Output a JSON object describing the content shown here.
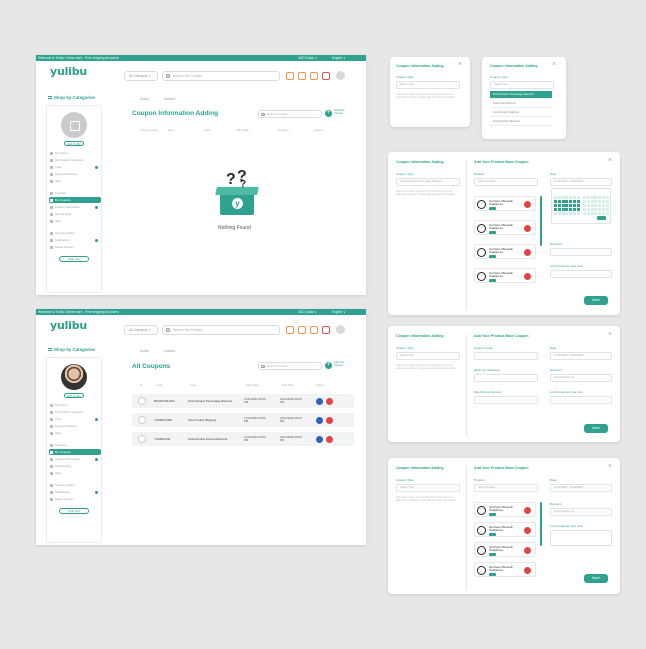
{
  "header": {
    "promo": "Welcome to Yulibu Online store - Free shipping all orders",
    "lang1": "USD Dollar ∨",
    "lang2": "English ∨",
    "logo": "yulibu",
    "category": "All Category ∨",
    "search_placeholder": "Search the Product",
    "colors": {
      "brand": "#2fa18e"
    }
  },
  "sidebar": {
    "title": "Shop by Categories",
    "edit": "Edit Profile",
    "items": [
      "My Orders",
      "My Product Collections",
      "Chat",
      "Payment Settings",
      "Help",
      "Favorites",
      "My Coupons",
      "Coupon Information",
      "Shop Setting",
      "Help"
    ],
    "items2": [
      "Security Setting",
      "Notifications",
      "Delete Account"
    ],
    "signout": "Sign Out"
  },
  "screen1": {
    "tabs": [
      "Active",
      "Inactive"
    ],
    "title": "Coupon Information Adding",
    "search": "Search Coupon",
    "add": "Add New Coupon",
    "columns": [
      "Coupon Code",
      "Date",
      "Type",
      "Start Date",
      "Duration",
      "Actions"
    ],
    "empty": "Nothing Found"
  },
  "screen2": {
    "tabs": [
      "Active",
      "Inactive"
    ],
    "title": "All Coupons",
    "search": "Search Coupon",
    "add": "Add New Coupon",
    "columns": [
      "#",
      "Code",
      "Type",
      "Start Date",
      "End Date",
      "Actions"
    ],
    "rows": [
      {
        "code": "BOUN12341234",
        "type": "Fixed Product Percentage Discount",
        "start": "11/12/2022 09:00 PM",
        "end": "24/12/2022 09:00 PM"
      },
      {
        "code": "YULIBU12345",
        "type": "Free Product Shipping",
        "start": "11/12/2022 09:00 PM",
        "end": "24/12/2022 09:00 PM"
      },
      {
        "code": "YULIBU1234",
        "type": "Fixed Product Amount Discount",
        "start": "11/12/2022 09:00 PM",
        "end": "24/12/2022 09:00 PM"
      }
    ]
  },
  "dialogs": {
    "title": "Coupon Information Adding",
    "type_label": "Coupon Type",
    "type_placeholder": "Select Type",
    "type_selected": "Fixed Product Percentage Discount",
    "hint": "Select the coupon type from the list and then you can add coupon product, coupon date and other information.",
    "options": [
      "Fixed Product Percentage Discount",
      "Fixed Cart Discount",
      "Free Product Shipping",
      "Fixed Product Discount"
    ],
    "title2": "Add Your Product Base Coupon",
    "product_label": "Product",
    "product_placeholder": "Select Product",
    "coupon_code_label": "Coupon Code",
    "date_label": "Date",
    "date_value": "11/12/2022 - 24/12/2022",
    "discount_label": "Discount",
    "discount_value": "Fixed Product %",
    "min_label": "Minimum Shopping",
    "maxdisc_label": "Max Product Amount",
    "limit_label": "Limit Customer Use Use",
    "product_name": "Sennheiser Bluetooth Headphones",
    "save": "Save",
    "close": "×"
  }
}
